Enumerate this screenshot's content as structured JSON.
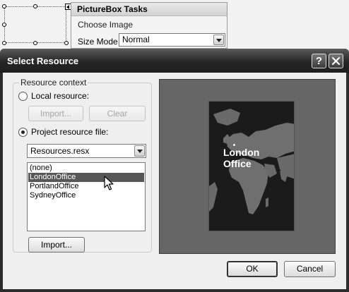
{
  "designer": {
    "tasks_title": "PictureBox Tasks",
    "choose_image_link": "Choose Image",
    "size_mode_label": "Size Mode",
    "size_mode_value": "Normal"
  },
  "dialog": {
    "title": "Select Resource",
    "help_glyph": "?",
    "resource_context_label": "Resource context",
    "local_resource_label": "Local resource:",
    "import_local_label": "Import...",
    "clear_label": "Clear",
    "project_resource_label": "Project resource file:",
    "resource_file_value": "Resources.resx",
    "resources": [
      "(none)",
      "LondonOffice",
      "PortlandOffice",
      "SydneyOffice"
    ],
    "selected_resource": "LondonOffice",
    "import_project_label": "Import...",
    "ok_label": "OK",
    "cancel_label": "Cancel"
  },
  "preview": {
    "caption_line1": "London",
    "caption_line2": "Office"
  },
  "icons": {
    "help": "help-icon",
    "close": "close-icon",
    "dropdown": "chevron-down-icon",
    "smart_tag": "smart-tag-arrow-icon",
    "cursor": "mouse-pointer-icon"
  },
  "colors": {
    "title_bar": "#262626",
    "selection": "#575757",
    "preview_bg": "#666666",
    "image_bg": "#1b1b1b"
  }
}
